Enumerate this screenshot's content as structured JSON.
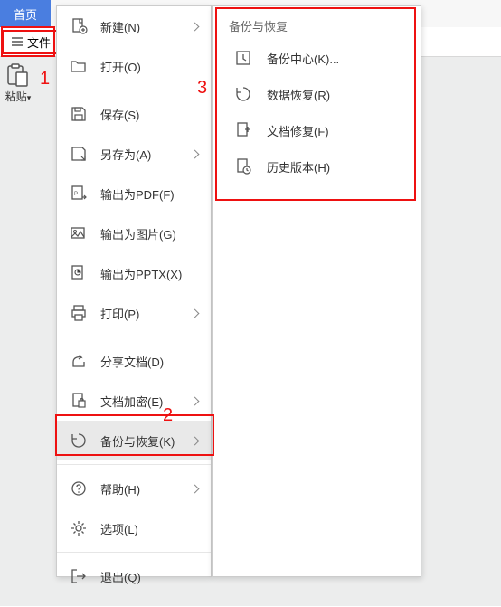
{
  "tabs": {
    "home": "首页"
  },
  "ribbon": {
    "file": "文件",
    "paste": "粘贴"
  },
  "annotations": {
    "one": "1",
    "two": "2",
    "three": "3"
  },
  "menu": {
    "new": {
      "label": "新建(N)"
    },
    "open": {
      "label": "打开(O)"
    },
    "save": {
      "label": "保存(S)"
    },
    "saveas": {
      "label": "另存为(A)"
    },
    "pdf": {
      "label": "输出为PDF(F)"
    },
    "img": {
      "label": "输出为图片(G)"
    },
    "pptx": {
      "label": "输出为PPTX(X)"
    },
    "print": {
      "label": "打印(P)"
    },
    "share": {
      "label": "分享文档(D)"
    },
    "encrypt": {
      "label": "文档加密(E)"
    },
    "backup": {
      "label": "备份与恢复(K)"
    },
    "help": {
      "label": "帮助(H)"
    },
    "options": {
      "label": "选项(L)"
    },
    "exit": {
      "label": "退出(Q)"
    }
  },
  "submenu": {
    "title": "备份与恢复",
    "center": {
      "label": "备份中心(K)..."
    },
    "recover": {
      "label": "数据恢复(R)"
    },
    "repair": {
      "label": "文档修复(F)"
    },
    "history": {
      "label": "历史版本(H)"
    }
  }
}
